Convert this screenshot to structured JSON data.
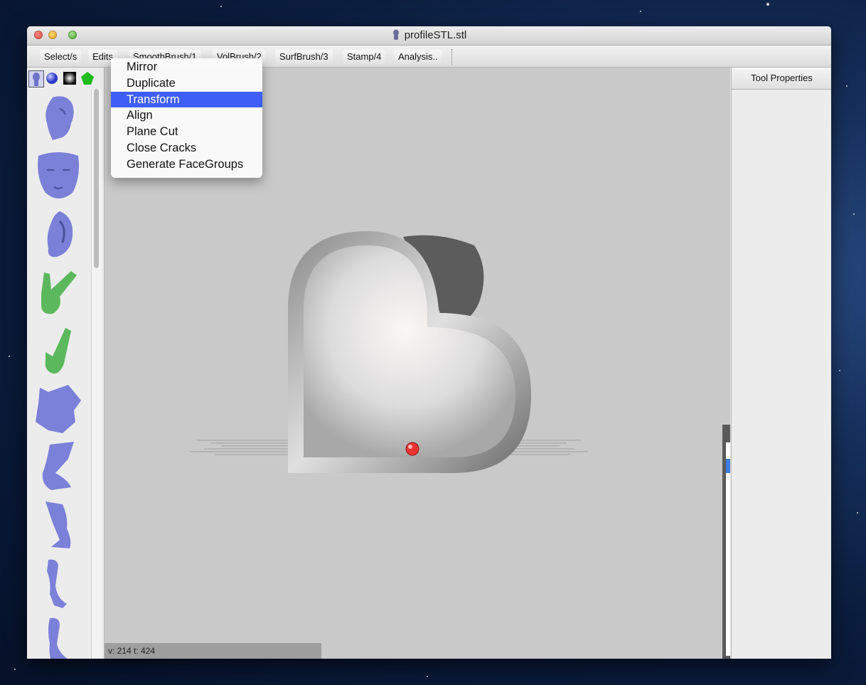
{
  "window": {
    "title": "profileSTL.stl"
  },
  "toolbar": {
    "items": [
      {
        "label": "Select/s"
      },
      {
        "label": "Edits"
      },
      {
        "label": "SmoothBrush/1"
      },
      {
        "label": "VolBrush/2"
      },
      {
        "label": "SurfBrush/3"
      },
      {
        "label": "Stamp/4"
      },
      {
        "label": "Analysis.."
      }
    ]
  },
  "edits_menu": {
    "items": [
      {
        "label": "Mirror"
      },
      {
        "label": "Duplicate"
      },
      {
        "label": "Transform",
        "selected": true
      },
      {
        "label": "Align"
      },
      {
        "label": "Plane Cut"
      },
      {
        "label": "Close Cracks"
      },
      {
        "label": "Generate FaceGroups"
      }
    ]
  },
  "sidebar": {
    "type_tabs": [
      "head-icon",
      "sphere-icon",
      "square-gradient-icon",
      "pentagon-icon"
    ],
    "thumbnails": [
      {
        "name": "head-thumbnail",
        "color": "#7b80d8"
      },
      {
        "name": "face-thumbnail",
        "color": "#7b80d8"
      },
      {
        "name": "ear-thumbnail",
        "color": "#7b80d8"
      },
      {
        "name": "hand-peace-thumbnail",
        "color": "#5cb85c"
      },
      {
        "name": "hand-thumbnail",
        "color": "#5cb85c"
      },
      {
        "name": "torso-thumbnail",
        "color": "#7b80d8"
      },
      {
        "name": "foot-thumbnail",
        "color": "#7b80d8"
      },
      {
        "name": "foot2-thumbnail",
        "color": "#7b80d8"
      },
      {
        "name": "leg-thumbnail",
        "color": "#7b80d8"
      },
      {
        "name": "leg2-thumbnail",
        "color": "#7b80d8"
      }
    ]
  },
  "viewport": {
    "status": "v: 214  t: 424"
  },
  "properties": {
    "title": "Tool Properties"
  },
  "colors": {
    "selection": "#3f5ef6",
    "mesh_blue": "#7b80d8",
    "mesh_green": "#5cb85c",
    "pivot": "#e33"
  }
}
